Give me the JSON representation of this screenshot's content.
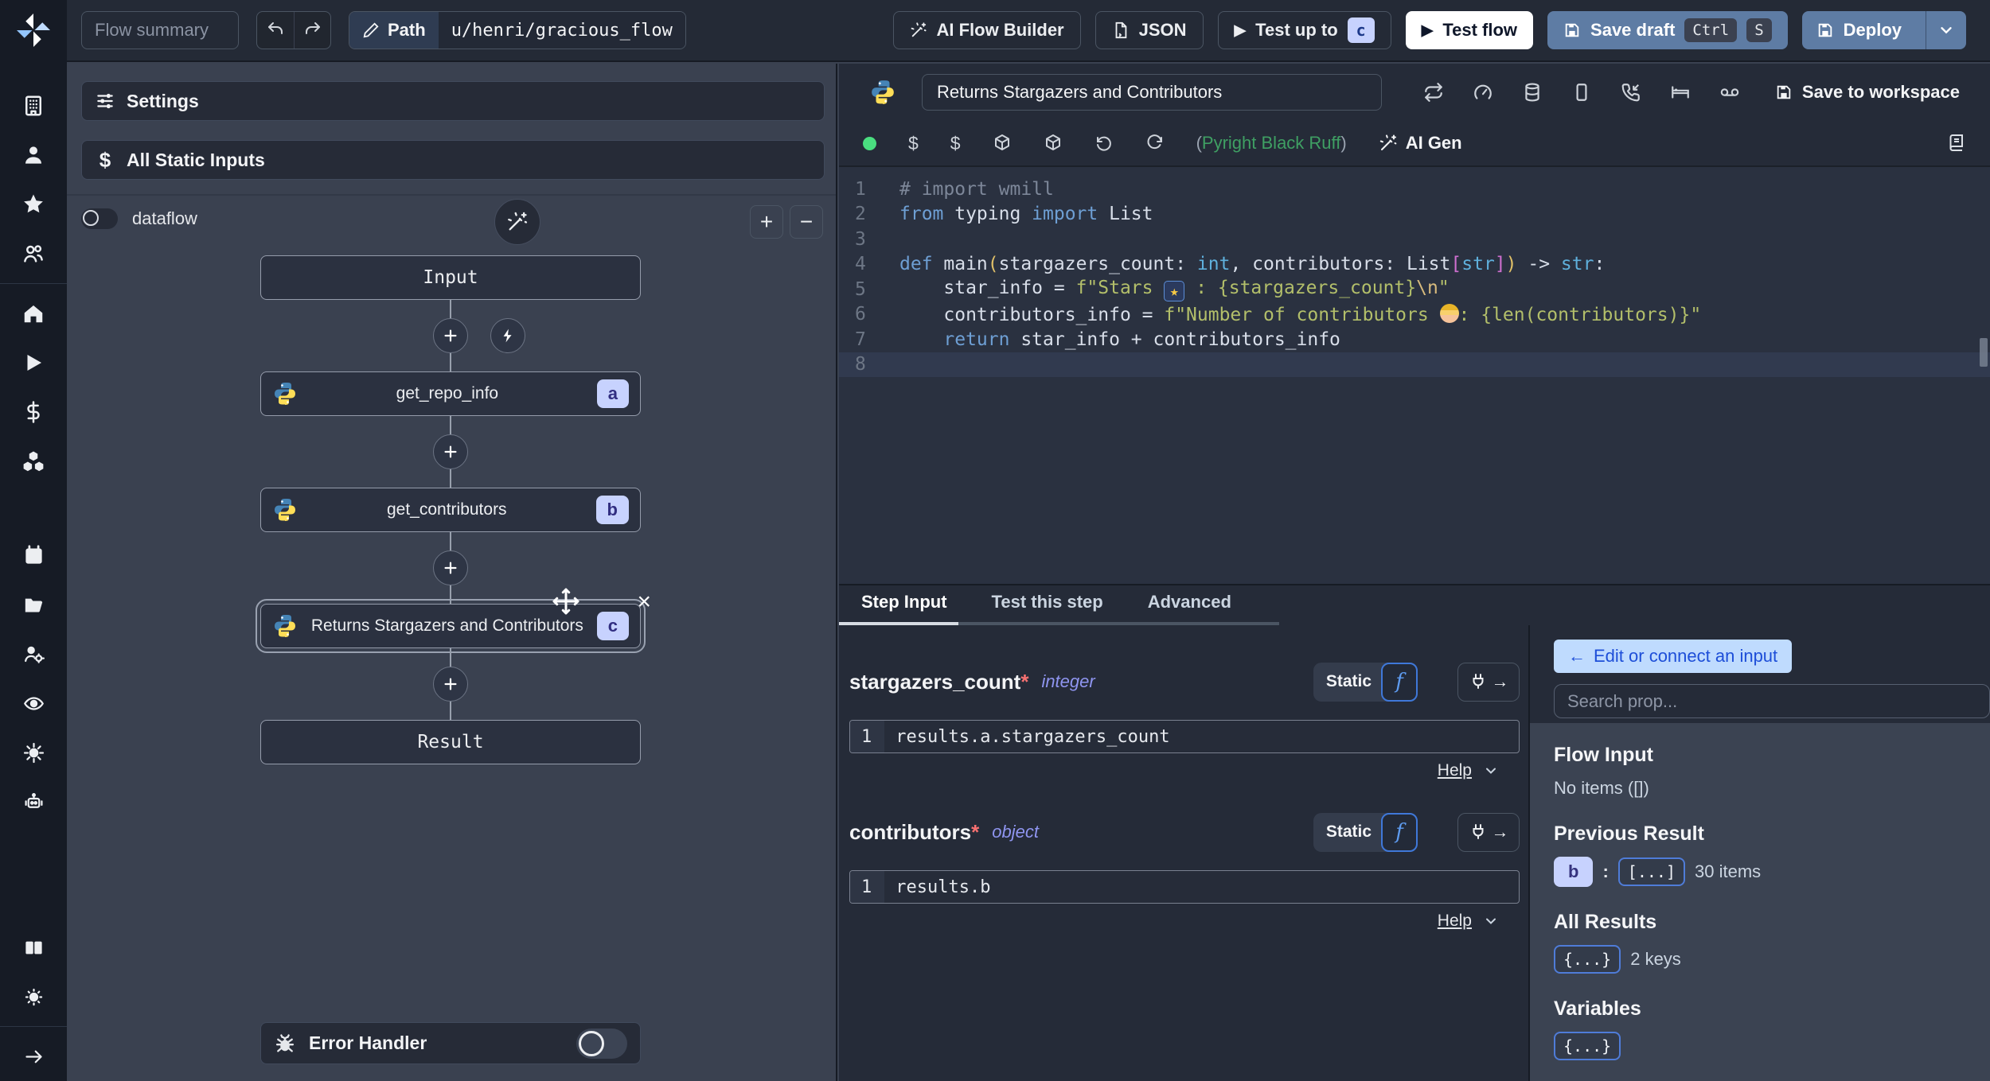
{
  "topbar": {
    "flow_summary_placeholder": "Flow summary",
    "path_label": "Path",
    "path_value": "u/henri/gracious_flow",
    "ai_flow_builder": "AI Flow Builder",
    "json_label": "JSON",
    "test_up_to": "Test up to",
    "test_up_to_badge": "c",
    "test_flow": "Test flow",
    "save_draft": "Save draft",
    "save_draft_keys": [
      "Ctrl",
      "S"
    ],
    "deploy": "Deploy"
  },
  "sidebar": {
    "icon_groups": [
      [
        "workspace",
        "user",
        "favorites",
        "groups"
      ],
      [
        "home",
        "runs",
        "variables",
        "resources"
      ],
      [
        "schedules",
        "folders",
        "workers",
        "audit-logs",
        "settings",
        "ai"
      ],
      [
        "docs",
        "theme"
      ],
      [
        "expand"
      ]
    ]
  },
  "flow_panel": {
    "settings": "Settings",
    "all_static_inputs": "All Static Inputs",
    "dataflow": "dataflow",
    "input_node": "Input",
    "result_node": "Result",
    "error_handler": "Error Handler",
    "steps": [
      {
        "id": "a",
        "label": "get_repo_info",
        "selected": false
      },
      {
        "id": "b",
        "label": "get_contributors",
        "selected": false
      },
      {
        "id": "c",
        "label": "Returns Stargazers and Contributors",
        "selected": true
      }
    ]
  },
  "editor": {
    "title": "Returns Stargazers and Contributors",
    "lint_open": "(",
    "lint_text": "Pyright Black Ruff",
    "lint_close": ")",
    "ai_gen": "AI Gen",
    "save_to_workspace": "Save to workspace",
    "code": [
      {
        "tokens": [
          [
            "com",
            "# import wmill"
          ]
        ]
      },
      {
        "tokens": [
          [
            "kw",
            "from"
          ],
          [
            "id",
            " typing "
          ],
          [
            "kw",
            "import"
          ],
          [
            "id",
            " List"
          ]
        ]
      },
      {
        "tokens": []
      },
      {
        "tokens": [
          [
            "kw",
            "def "
          ],
          [
            "id",
            "main"
          ],
          [
            "par",
            "("
          ],
          [
            "id",
            "stargazers_count: "
          ],
          [
            "ty",
            "int"
          ],
          [
            "id",
            ", contributors: List"
          ],
          [
            "br",
            "["
          ],
          [
            "ty",
            "str"
          ],
          [
            "br",
            "]"
          ],
          [
            "par",
            ")"
          ],
          [
            "id",
            " -> "
          ],
          [
            "ty",
            "str"
          ],
          [
            "id",
            ":"
          ]
        ]
      },
      {
        "tokens": [
          [
            "id",
            "    star_info = "
          ],
          [
            "str",
            "f\"Stars "
          ],
          [
            "emoji-star",
            "★"
          ],
          [
            "str",
            " : {stargazers_count}"
          ],
          [
            "esc",
            "\\n"
          ],
          [
            "str",
            "\""
          ]
        ]
      },
      {
        "tokens": [
          [
            "id",
            "    contributors_info = "
          ],
          [
            "str",
            "f\"Number of contributors "
          ],
          [
            "emoji-worker",
            ""
          ],
          [
            "str",
            ": {len(contributors)}\""
          ]
        ]
      },
      {
        "tokens": [
          [
            "kw",
            "    return"
          ],
          [
            "id",
            " star_info + contributors_info"
          ]
        ]
      },
      {
        "tokens": [],
        "active": true
      }
    ]
  },
  "step_panel": {
    "tabs": [
      {
        "label": "Step Input",
        "active": true
      },
      {
        "label": "Test this step",
        "active": false
      },
      {
        "label": "Advanced",
        "active": false
      }
    ],
    "fields": [
      {
        "name": "stargazers_count",
        "required": "*",
        "type": "integer",
        "mode": "Static",
        "line_no": "1",
        "code": "results.a.stargazers_count",
        "help": "Help"
      },
      {
        "name": "contributors",
        "required": "*",
        "type": "object",
        "mode": "Static",
        "line_no": "1",
        "code": "results.b",
        "help": "Help"
      }
    ]
  },
  "prop_panel": {
    "edit_button": "Edit or connect an input",
    "search_placeholder": "Search prop...",
    "flow_input_title": "Flow Input",
    "flow_input_empty": "No items ([])",
    "previous_result_title": "Previous Result",
    "previous_result_key": "b",
    "previous_result_value": "[...]",
    "previous_result_count": "30 items",
    "all_results_title": "All Results",
    "all_results_value": "{...}",
    "all_results_count": "2 keys",
    "variables_title": "Variables",
    "variables_value": "{...}"
  },
  "colors": {
    "action_blue": "#5e7ca4",
    "badge_lavender": "#c7d2fe",
    "lint_green": "#4ade80",
    "edit_button_bg": "#bfdbfe"
  }
}
